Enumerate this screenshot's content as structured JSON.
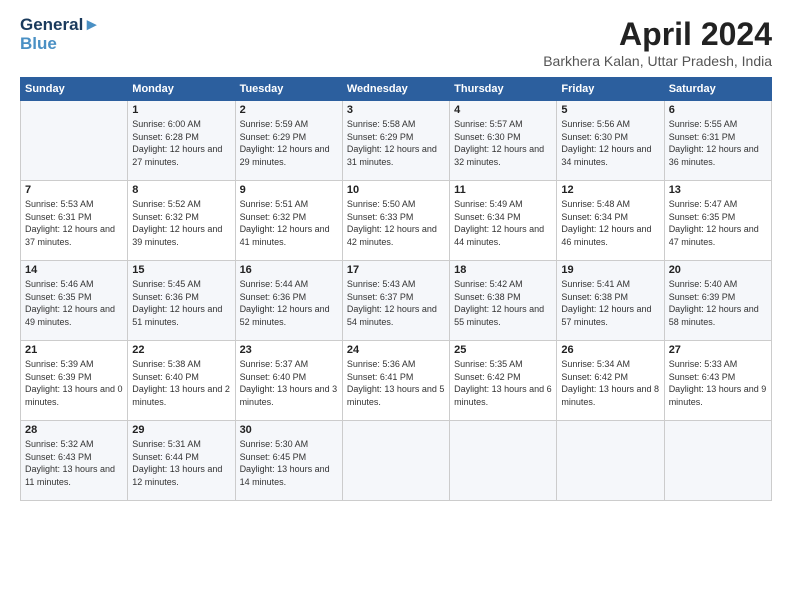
{
  "logo": {
    "line1": "General",
    "line2": "Blue"
  },
  "title": "April 2024",
  "location": "Barkhera Kalan, Uttar Pradesh, India",
  "weekdays": [
    "Sunday",
    "Monday",
    "Tuesday",
    "Wednesday",
    "Thursday",
    "Friday",
    "Saturday"
  ],
  "weeks": [
    [
      {
        "day": "",
        "detail": ""
      },
      {
        "day": "1",
        "detail": "Sunrise: 6:00 AM\nSunset: 6:28 PM\nDaylight: 12 hours\nand 27 minutes."
      },
      {
        "day": "2",
        "detail": "Sunrise: 5:59 AM\nSunset: 6:29 PM\nDaylight: 12 hours\nand 29 minutes."
      },
      {
        "day": "3",
        "detail": "Sunrise: 5:58 AM\nSunset: 6:29 PM\nDaylight: 12 hours\nand 31 minutes."
      },
      {
        "day": "4",
        "detail": "Sunrise: 5:57 AM\nSunset: 6:30 PM\nDaylight: 12 hours\nand 32 minutes."
      },
      {
        "day": "5",
        "detail": "Sunrise: 5:56 AM\nSunset: 6:30 PM\nDaylight: 12 hours\nand 34 minutes."
      },
      {
        "day": "6",
        "detail": "Sunrise: 5:55 AM\nSunset: 6:31 PM\nDaylight: 12 hours\nand 36 minutes."
      }
    ],
    [
      {
        "day": "7",
        "detail": "Sunrise: 5:53 AM\nSunset: 6:31 PM\nDaylight: 12 hours\nand 37 minutes."
      },
      {
        "day": "8",
        "detail": "Sunrise: 5:52 AM\nSunset: 6:32 PM\nDaylight: 12 hours\nand 39 minutes."
      },
      {
        "day": "9",
        "detail": "Sunrise: 5:51 AM\nSunset: 6:32 PM\nDaylight: 12 hours\nand 41 minutes."
      },
      {
        "day": "10",
        "detail": "Sunrise: 5:50 AM\nSunset: 6:33 PM\nDaylight: 12 hours\nand 42 minutes."
      },
      {
        "day": "11",
        "detail": "Sunrise: 5:49 AM\nSunset: 6:34 PM\nDaylight: 12 hours\nand 44 minutes."
      },
      {
        "day": "12",
        "detail": "Sunrise: 5:48 AM\nSunset: 6:34 PM\nDaylight: 12 hours\nand 46 minutes."
      },
      {
        "day": "13",
        "detail": "Sunrise: 5:47 AM\nSunset: 6:35 PM\nDaylight: 12 hours\nand 47 minutes."
      }
    ],
    [
      {
        "day": "14",
        "detail": "Sunrise: 5:46 AM\nSunset: 6:35 PM\nDaylight: 12 hours\nand 49 minutes."
      },
      {
        "day": "15",
        "detail": "Sunrise: 5:45 AM\nSunset: 6:36 PM\nDaylight: 12 hours\nand 51 minutes."
      },
      {
        "day": "16",
        "detail": "Sunrise: 5:44 AM\nSunset: 6:36 PM\nDaylight: 12 hours\nand 52 minutes."
      },
      {
        "day": "17",
        "detail": "Sunrise: 5:43 AM\nSunset: 6:37 PM\nDaylight: 12 hours\nand 54 minutes."
      },
      {
        "day": "18",
        "detail": "Sunrise: 5:42 AM\nSunset: 6:38 PM\nDaylight: 12 hours\nand 55 minutes."
      },
      {
        "day": "19",
        "detail": "Sunrise: 5:41 AM\nSunset: 6:38 PM\nDaylight: 12 hours\nand 57 minutes."
      },
      {
        "day": "20",
        "detail": "Sunrise: 5:40 AM\nSunset: 6:39 PM\nDaylight: 12 hours\nand 58 minutes."
      }
    ],
    [
      {
        "day": "21",
        "detail": "Sunrise: 5:39 AM\nSunset: 6:39 PM\nDaylight: 13 hours\nand 0 minutes."
      },
      {
        "day": "22",
        "detail": "Sunrise: 5:38 AM\nSunset: 6:40 PM\nDaylight: 13 hours\nand 2 minutes."
      },
      {
        "day": "23",
        "detail": "Sunrise: 5:37 AM\nSunset: 6:40 PM\nDaylight: 13 hours\nand 3 minutes."
      },
      {
        "day": "24",
        "detail": "Sunrise: 5:36 AM\nSunset: 6:41 PM\nDaylight: 13 hours\nand 5 minutes."
      },
      {
        "day": "25",
        "detail": "Sunrise: 5:35 AM\nSunset: 6:42 PM\nDaylight: 13 hours\nand 6 minutes."
      },
      {
        "day": "26",
        "detail": "Sunrise: 5:34 AM\nSunset: 6:42 PM\nDaylight: 13 hours\nand 8 minutes."
      },
      {
        "day": "27",
        "detail": "Sunrise: 5:33 AM\nSunset: 6:43 PM\nDaylight: 13 hours\nand 9 minutes."
      }
    ],
    [
      {
        "day": "28",
        "detail": "Sunrise: 5:32 AM\nSunset: 6:43 PM\nDaylight: 13 hours\nand 11 minutes."
      },
      {
        "day": "29",
        "detail": "Sunrise: 5:31 AM\nSunset: 6:44 PM\nDaylight: 13 hours\nand 12 minutes."
      },
      {
        "day": "30",
        "detail": "Sunrise: 5:30 AM\nSunset: 6:45 PM\nDaylight: 13 hours\nand 14 minutes."
      },
      {
        "day": "",
        "detail": ""
      },
      {
        "day": "",
        "detail": ""
      },
      {
        "day": "",
        "detail": ""
      },
      {
        "day": "",
        "detail": ""
      }
    ]
  ]
}
